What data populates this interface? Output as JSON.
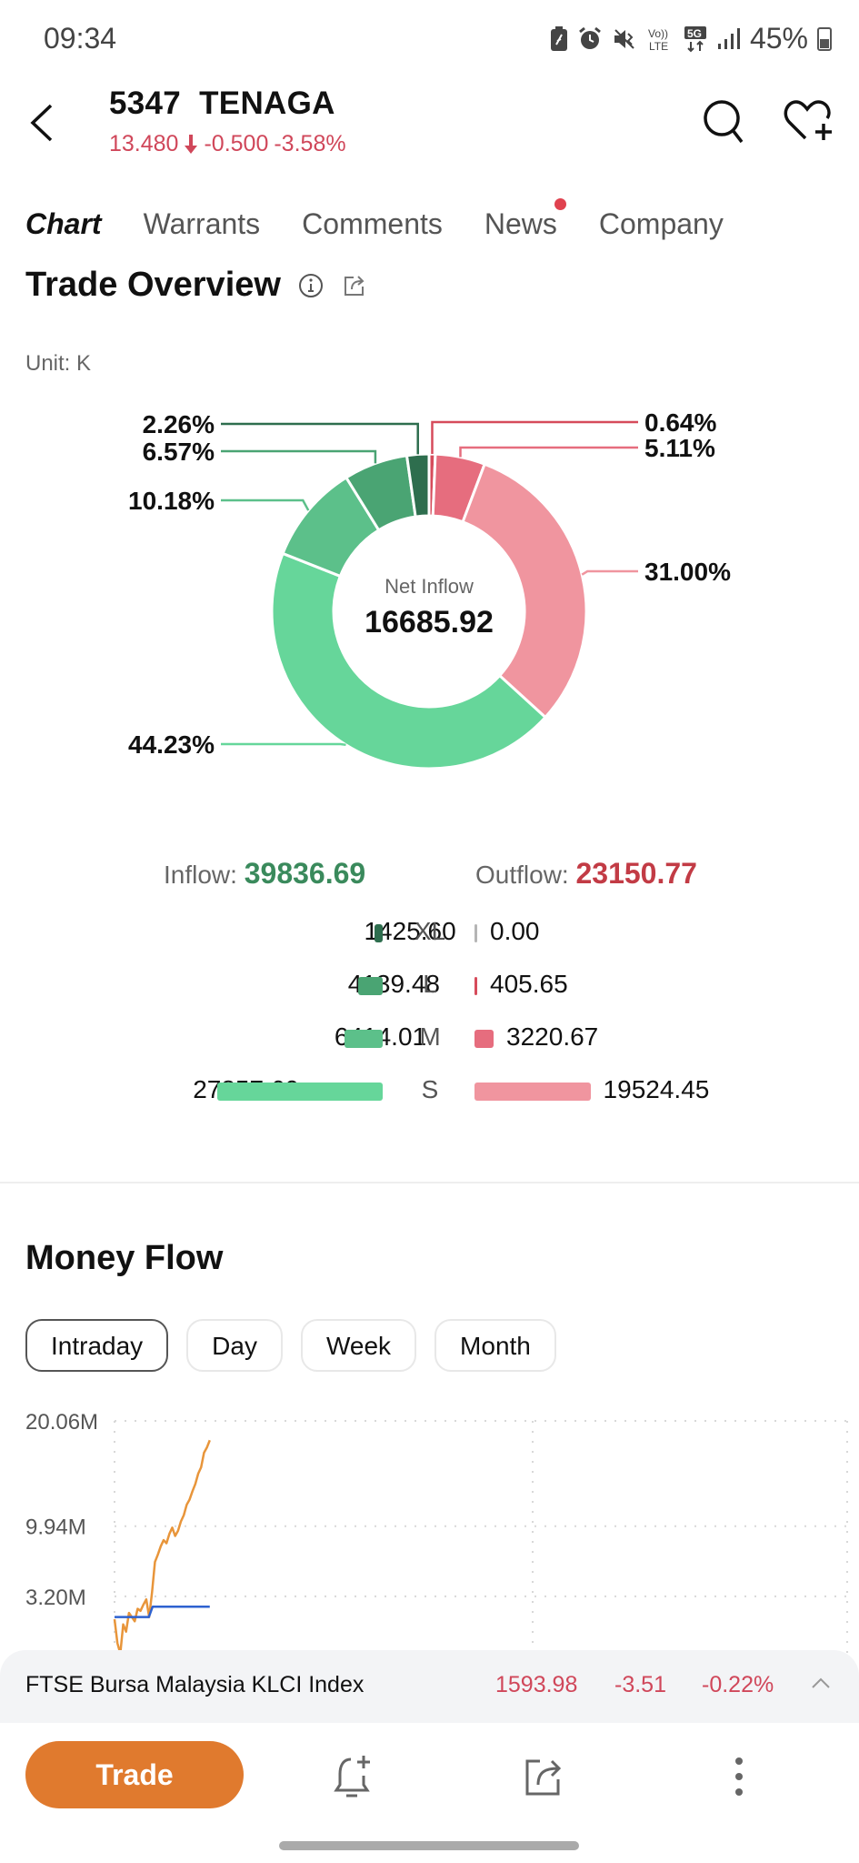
{
  "status_bar": {
    "time": "09:34",
    "battery": "45%",
    "icons": [
      "battery-saver-icon",
      "alarm-icon",
      "mute-icon",
      "volte-icon",
      "5g-icon",
      "signal-icon",
      "battery-icon"
    ]
  },
  "header": {
    "code": "5347",
    "name": "TENAGA",
    "price": "13.480",
    "change": "-0.500",
    "change_pct": "-3.58%",
    "direction": "down"
  },
  "tabs": [
    {
      "label": "Chart",
      "active": true
    },
    {
      "label": "Warrants",
      "active": false
    },
    {
      "label": "Comments",
      "active": false
    },
    {
      "label": "News",
      "active": false,
      "badge_dot": true
    },
    {
      "label": "Company",
      "active": false
    }
  ],
  "trade_overview": {
    "title": "Trade Overview",
    "unit": "Unit: K",
    "center_label": "Net Inflow",
    "center_value": "16685.92",
    "inflow_label": "Inflow:",
    "inflow_value": "39836.69",
    "outflow_label": "Outflow:",
    "outflow_value": "23150.77",
    "rows": [
      {
        "category": "XL",
        "inflow": "1425.60",
        "outflow": "0.00",
        "inflow_num": 1425.6,
        "outflow_num": 0.0
      },
      {
        "category": "L",
        "inflow": "4139.48",
        "outflow": "405.65",
        "inflow_num": 4139.48,
        "outflow_num": 405.65
      },
      {
        "category": "M",
        "inflow": "6414.01",
        "outflow": "3220.67",
        "inflow_num": 6414.01,
        "outflow_num": 3220.67
      },
      {
        "category": "S",
        "inflow": "27857.60",
        "outflow": "19524.45",
        "inflow_num": 27857.6,
        "outflow_num": 19524.45
      }
    ],
    "colors": {
      "inflow_xl": "#2e6e4e",
      "inflow_l": "#4aa473",
      "inflow_m": "#5cc08a",
      "inflow_s": "#66d69a",
      "outflow_xl": "#d64b5b",
      "outflow_l": "#d64b5b",
      "outflow_m": "#e66d7e",
      "outflow_s": "#f0959f",
      "inflow_text": "#3a8a5c",
      "outflow_text": "#c23b45"
    }
  },
  "chart_data": {
    "type": "pie",
    "title": "Trade Overview",
    "donut": true,
    "center_label": "Net Inflow",
    "center_value": 16685.92,
    "slices": [
      {
        "label": "Outflow XL",
        "percent": 0.64,
        "display": "0.64%",
        "color": "#d64b5b"
      },
      {
        "label": "Outflow L",
        "percent": 5.11,
        "display": "5.11%",
        "color": "#e66d7e"
      },
      {
        "label": "Outflow S/M",
        "percent": 31.0,
        "display": "31.00%",
        "color": "#f0959f"
      },
      {
        "label": "Inflow S",
        "percent": 44.23,
        "display": "44.23%",
        "color": "#66d69a"
      },
      {
        "label": "Inflow M",
        "percent": 10.18,
        "display": "10.18%",
        "color": "#5cc08a"
      },
      {
        "label": "Inflow L",
        "percent": 6.57,
        "display": "6.57%",
        "color": "#4aa473"
      },
      {
        "label": "Inflow XL",
        "percent": 2.26,
        "display": "2.26%",
        "color": "#2e6e4e"
      }
    ]
  },
  "money_flow": {
    "title": "Money Flow",
    "periods": [
      {
        "label": "Intraday",
        "active": true
      },
      {
        "label": "Day",
        "active": false
      },
      {
        "label": "Week",
        "active": false
      },
      {
        "label": "Month",
        "active": false
      }
    ],
    "y_ticks": [
      "20.06M",
      "9.94M",
      "3.20M"
    ],
    "y_tick_values": [
      20.06,
      9.94,
      3.2
    ],
    "y_min": -2.5,
    "y_max": 20.06,
    "x_fraction_shown": 0.13,
    "series": [
      {
        "name": "orange",
        "color": "#e8953a",
        "values": [
          1.0,
          -1.3,
          -2.3,
          0.5,
          -0.2,
          1.6,
          1.2,
          0.8,
          2.0,
          1.8,
          2.4,
          2.9,
          1.2,
          3.6,
          6.5,
          7.2,
          8.0,
          8.6,
          8.3,
          9.2,
          9.8,
          9.0,
          9.5,
          10.4,
          11.0,
          12.0,
          12.5,
          13.3,
          14.0,
          15.0,
          15.6,
          17.0,
          17.5,
          18.2
        ]
      },
      {
        "name": "blue",
        "color": "#2e62d0",
        "values": [
          1.2,
          1.2,
          1.2,
          1.2,
          1.2,
          1.2,
          1.2,
          1.2,
          1.2,
          1.2,
          2.2,
          2.2,
          2.2,
          2.2,
          2.2,
          2.2,
          2.2,
          2.2,
          2.2,
          2.2,
          2.2,
          2.2,
          2.2,
          2.2,
          2.2,
          2.2
        ]
      }
    ]
  },
  "index_bar": {
    "name": "FTSE Bursa Malaysia KLCI Index",
    "value": "1593.98",
    "change": "-3.51",
    "change_pct": "-0.22%"
  },
  "bottom_bar": {
    "trade_label": "Trade",
    "icons": [
      "add-alert-icon",
      "share-icon",
      "more-icon"
    ]
  }
}
